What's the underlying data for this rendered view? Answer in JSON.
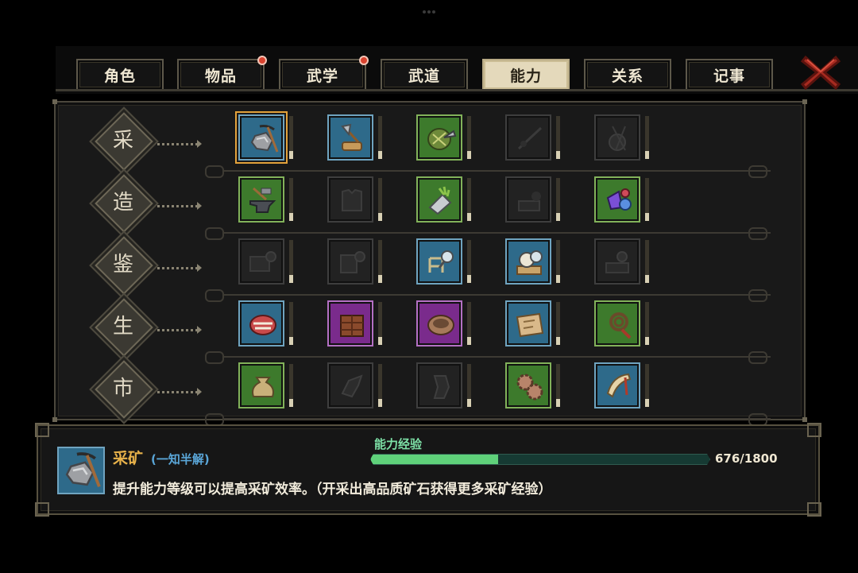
{
  "tabs": [
    {
      "label": "角色",
      "active": false,
      "badge": false
    },
    {
      "label": "物品",
      "active": false,
      "badge": true
    },
    {
      "label": "武学",
      "active": false,
      "badge": true
    },
    {
      "label": "武道",
      "active": false,
      "badge": false
    },
    {
      "label": "能力",
      "active": true,
      "badge": false
    },
    {
      "label": "关系",
      "active": false,
      "badge": false
    },
    {
      "label": "记事",
      "active": false,
      "badge": false
    }
  ],
  "close_icon": "close-x-icon",
  "colors": {
    "accent_gold": "#e8b24a",
    "level_blue": "#5aa6d8",
    "exp_green": "#5fd17a",
    "exp_label": "#7de0a6",
    "selected_outline": "#e3a23b"
  },
  "categories": [
    {
      "char": "采",
      "items": [
        {
          "icon": "pickaxe-ore-icon",
          "style": "blue",
          "selected": true
        },
        {
          "icon": "axe-log-icon",
          "style": "blue"
        },
        {
          "icon": "herb-basket-icon",
          "style": "green"
        },
        {
          "icon": "fishing-rod-icon",
          "style": "dark"
        },
        {
          "icon": "yarn-needles-icon",
          "style": "dark"
        }
      ]
    },
    {
      "char": "造",
      "items": [
        {
          "icon": "anvil-hammer-icon",
          "style": "green"
        },
        {
          "icon": "armor-icon",
          "style": "dark"
        },
        {
          "icon": "cleaver-herbs-icon",
          "style": "green"
        },
        {
          "icon": "mortar-tools-icon",
          "style": "dark"
        },
        {
          "icon": "gem-crystals-icon",
          "style": "green"
        }
      ]
    },
    {
      "char": "鉴",
      "items": [
        {
          "icon": "book-lens-icon",
          "style": "dark"
        },
        {
          "icon": "armor-lens-icon",
          "style": "dark"
        },
        {
          "icon": "chair-lens-icon",
          "style": "blue"
        },
        {
          "icon": "skull-lens-icon",
          "style": "blue"
        },
        {
          "icon": "scroll-lens-icon",
          "style": "dark"
        }
      ]
    },
    {
      "char": "生",
      "items": [
        {
          "icon": "mouth-icon",
          "style": "blue"
        },
        {
          "icon": "chocolate-bar-icon",
          "style": "purple"
        },
        {
          "icon": "bowl-icon",
          "style": "purple"
        },
        {
          "icon": "map-scroll-icon",
          "style": "blue"
        },
        {
          "icon": "whip-icon",
          "style": "green"
        }
      ]
    },
    {
      "char": "市",
      "items": [
        {
          "icon": "money-bag-icon",
          "style": "green"
        },
        {
          "icon": "hand-icon",
          "style": "dark"
        },
        {
          "icon": "horse-head-icon",
          "style": "dark"
        },
        {
          "icon": "gears-icon",
          "style": "green"
        },
        {
          "icon": "horn-icon",
          "style": "blue"
        }
      ]
    }
  ],
  "skill": {
    "icon": "pickaxe-ore-icon",
    "name": "采矿",
    "level": "(一知半解)",
    "exp_label": "能力经验",
    "exp_current": 676,
    "exp_max": 1800,
    "exp_text": "676/1800",
    "description": "提升能力等级可以提高采矿效率。（开采出高品质矿石获得更多采矿经验）"
  }
}
